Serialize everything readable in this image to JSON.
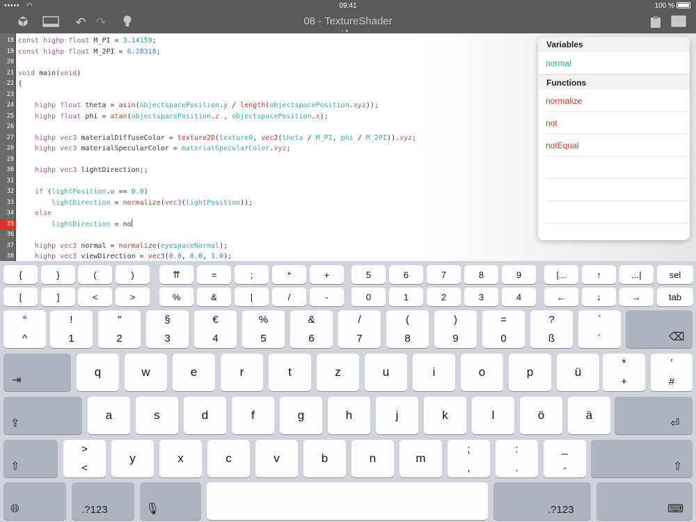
{
  "status": {
    "signal": "•••••",
    "time": "09:41",
    "battery": "100 %"
  },
  "toolbar": {
    "title": "08 - TextureShader"
  },
  "editor": {
    "lines": [
      {
        "n": "18",
        "html": "<span class=\"kw\">const</span> <span class=\"kw\">highp</span> <span class=\"kw\">float</span> M_PI = <span class=\"num\">3.14159</span>;"
      },
      {
        "n": "19",
        "html": "<span class=\"kw\">const</span> <span class=\"kw\">highp</span> <span class=\"kw\">float</span> M_2PI = <span class=\"num\">6.28318</span>;"
      },
      {
        "n": "20",
        "html": ""
      },
      {
        "n": "21",
        "html": "<span class=\"kw\">void</span> main(<span class=\"kw\">void</span>)"
      },
      {
        "n": "22",
        "html": "{"
      },
      {
        "n": "23",
        "html": ""
      },
      {
        "n": "24",
        "html": "    <span class=\"kw\">highp</span> <span class=\"kw\">float</span> theta = <span class=\"fn\">asin</span>(<span class=\"id\">objectspacePosition</span>.<span class=\"kw\">y</span> / <span class=\"fn\">length</span>(<span class=\"id\">objectspacePosition</span>.<span class=\"kw\">xyz</span>));"
      },
      {
        "n": "25",
        "html": "    <span class=\"kw\">highp</span> <span class=\"kw\">float</span> phi = <span class=\"fn\">atan</span>(<span class=\"id\">objectspacePosition</span>.<span class=\"kw\">z</span> , <span class=\"id\">objectspacePosition</span>.<span class=\"kw\">x</span>);"
      },
      {
        "n": "26",
        "html": ""
      },
      {
        "n": "27",
        "html": "    <span class=\"kw\">highp</span> <span class=\"kw\">vec3</span> materialDiffuseColor = <span class=\"fn\">texture2D</span>(<span class=\"id\">texture0</span>, <span class=\"fn\">vec2</span>(<span class=\"id\">theta</span> / <span class=\"id\">M_PI</span>, <span class=\"id\">phi</span> / <span class=\"id\">M_2PI</span>)).<span class=\"kw\">xyz</span>;"
      },
      {
        "n": "28",
        "html": "    <span class=\"kw\">highp</span> <span class=\"kw\">vec3</span> materialSpecularColor = <span class=\"id\">materialSpecularColor</span>.<span class=\"kw\">xyz</span>;"
      },
      {
        "n": "29",
        "html": ""
      },
      {
        "n": "30",
        "html": "    <span class=\"kw\">highp</span> <span class=\"kw\">vec3</span> lightDirection;;"
      },
      {
        "n": "31",
        "html": ""
      },
      {
        "n": "32",
        "html": "    <span class=\"kw\">if</span> (<span class=\"id\">lightPosition</span>.<span class=\"kw\">w</span> == <span class=\"num\">0.0</span>)"
      },
      {
        "n": "33",
        "html": "        <span class=\"id\">lightDirection</span> = <span class=\"fn\">normalize</span>(<span class=\"kw\">vec3</span>(<span class=\"id\">lightPosition</span>));"
      },
      {
        "n": "34",
        "html": "    <span class=\"kw\">else</span>"
      },
      {
        "n": "35",
        "html": "        <span class=\"id\">lightDirection</span> = no<span class=\"cursor\"></span>",
        "err": true
      },
      {
        "n": "36",
        "html": ""
      },
      {
        "n": "37",
        "html": "    <span class=\"kw\">highp</span> <span class=\"kw\">vec3</span> normal = <span class=\"fn\">normalize</span>(<span class=\"id\">eyespaceNormal</span>);"
      },
      {
        "n": "38",
        "html": "    <span class=\"kw\">highp</span> <span class=\"kw\">vec3</span> viewDirection = <span class=\"fn\">vec3</span>(<span class=\"num\">0.0</span>, <span class=\"num\">0.0</span>, <span class=\"num\">1.0</span>);"
      }
    ]
  },
  "popup": {
    "variables_label": "Variables",
    "variables": [
      "normal"
    ],
    "functions_label": "Functions",
    "functions": [
      "normalize",
      "not",
      "notEqual"
    ]
  },
  "keyboard": {
    "row1": [
      "{",
      "}",
      "(",
      ")",
      "⇈",
      "=",
      ";",
      "*",
      "+",
      "5",
      "6",
      "7",
      "8",
      "9",
      "|...",
      "↑",
      "...|",
      "sel"
    ],
    "row2": [
      "[",
      "]",
      "<",
      ">",
      "%",
      "&",
      "|",
      "/",
      "-",
      "0",
      "1",
      "2",
      "3",
      "4",
      "←",
      "↓",
      "→",
      "tab"
    ],
    "num_row": [
      [
        "°",
        "^"
      ],
      [
        "!",
        "1"
      ],
      [
        "″",
        "2"
      ],
      [
        "§",
        "3"
      ],
      [
        "€",
        "4"
      ],
      [
        "%",
        "5"
      ],
      [
        "&",
        "6"
      ],
      [
        "/",
        "7"
      ],
      [
        "(",
        "8"
      ],
      [
        ")",
        "9"
      ],
      [
        "=",
        "0"
      ],
      [
        "?",
        "ß"
      ],
      [
        "`",
        "´"
      ]
    ],
    "q_row": [
      "q",
      "w",
      "e",
      "r",
      "t",
      "z",
      "u",
      "i",
      "o",
      "p",
      "ü"
    ],
    "q_row_extra": [
      [
        "*",
        "+"
      ],
      [
        "′",
        "#"
      ]
    ],
    "a_row": [
      "a",
      "s",
      "d",
      "f",
      "g",
      "h",
      "j",
      "k",
      "l",
      "ö",
      "ä"
    ],
    "y_row": [
      [
        ">",
        "<"
      ],
      [
        "y"
      ],
      [
        "x"
      ],
      [
        "c"
      ],
      [
        "v"
      ],
      [
        "b"
      ],
      [
        "n"
      ],
      [
        "m"
      ],
      [
        ";",
        ","
      ],
      [
        ":",
        "."
      ],
      [
        "_",
        "-"
      ]
    ],
    "numbers_label": ".?123"
  }
}
